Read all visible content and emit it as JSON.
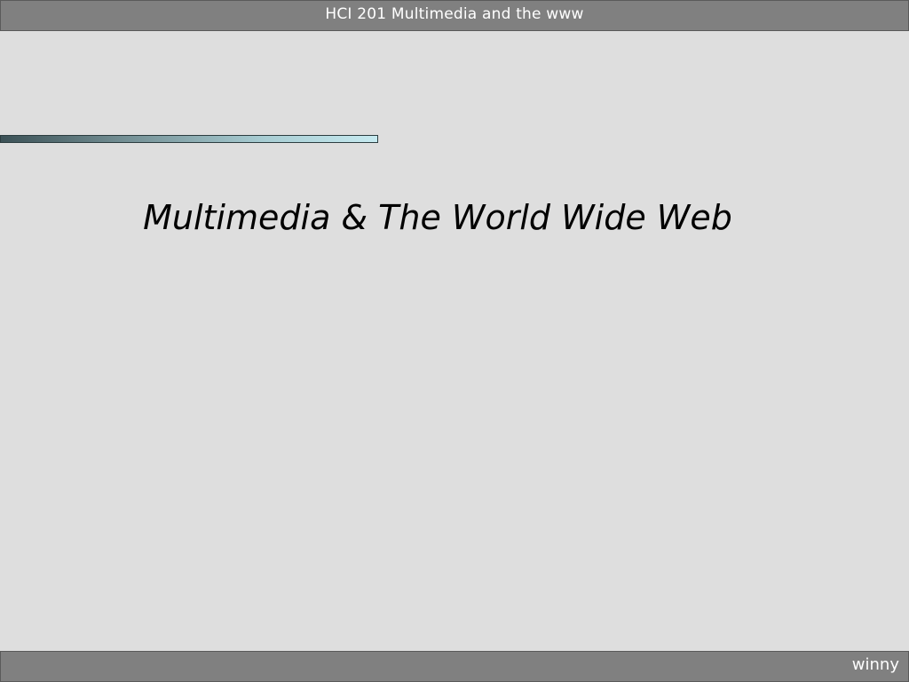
{
  "header": {
    "title": "HCI 201 Multimedia and the www"
  },
  "slide": {
    "title": "Multimedia & The World Wide Web"
  },
  "footer": {
    "author": "winny"
  },
  "colors": {
    "bar": "#808080",
    "background": "#dedede",
    "accent_start": "#3b5156",
    "accent_end": "#c6eaf0"
  }
}
